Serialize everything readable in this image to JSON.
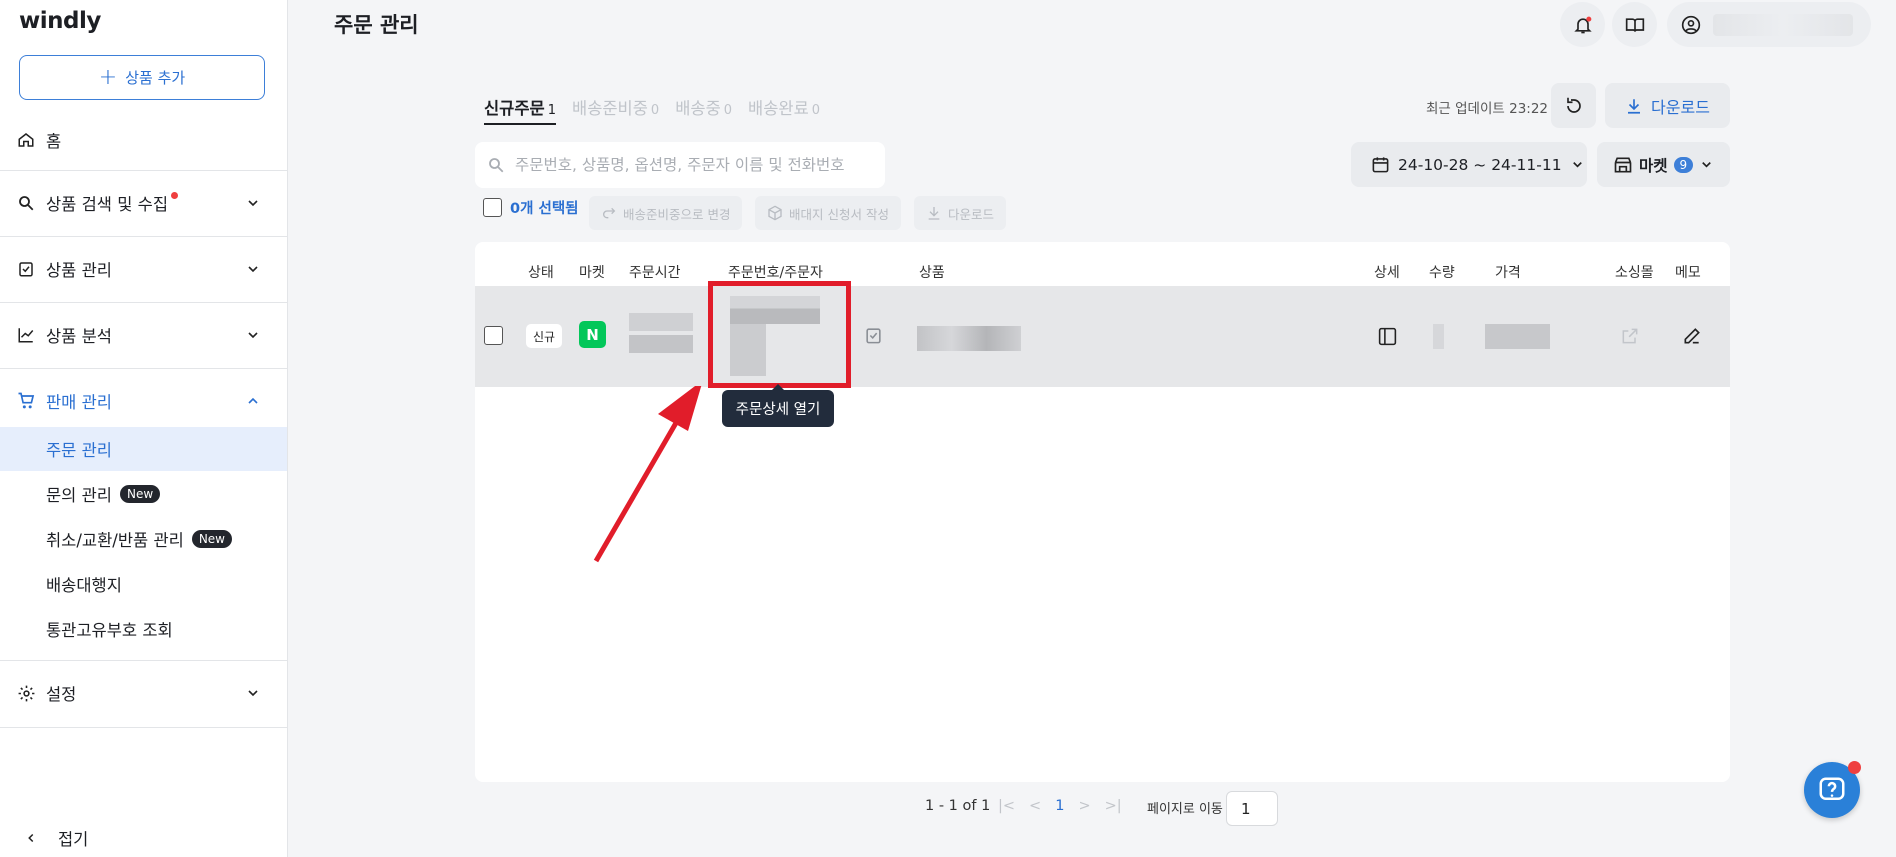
{
  "sidebar": {
    "logo": "windly",
    "add_button": "상품 추가",
    "home": "홈",
    "product_search": "상품 검색 및 수집",
    "product_manage": "상품 관리",
    "product_analysis": "상품 분석",
    "sales_manage": "판매 관리",
    "sub_items": [
      "주문 관리",
      "문의 관리",
      "취소/교환/반품 관리",
      "배송대행지",
      "통관고유부호 조회"
    ],
    "new_badge": "New",
    "settings": "설정",
    "collapse": "접기"
  },
  "header": {
    "title": "주문 관리"
  },
  "tabs": [
    {
      "label": "신규주문",
      "count": "1"
    },
    {
      "label": "배송준비중",
      "count": "0"
    },
    {
      "label": "배송중",
      "count": "0"
    },
    {
      "label": "배송완료",
      "count": "0"
    }
  ],
  "toolbar": {
    "last_update": "최근 업데이트 23:22",
    "download": "다운로드",
    "search_placeholder": "주문번호, 상품명, 옵션명, 주문자 이름 및 전화번호",
    "date_range": "24-10-28 ~ 24-11-11",
    "market_label": "마켓",
    "market_count": "9",
    "selected": "0개 선택됨",
    "change_status": "배송준비중으로 변경",
    "write_request": "배대지 신청서 작성",
    "download_small": "다운로드"
  },
  "table": {
    "headers": [
      "상태",
      "마켓",
      "주문시간",
      "주문번호/주문자",
      "상품",
      "상세",
      "수량",
      "가격",
      "소싱몰",
      "메모"
    ],
    "row": {
      "status": "신규",
      "market": "N"
    }
  },
  "tooltip": "주문상세 열기",
  "pagination": {
    "range": "1 - 1 of 1",
    "current": "1",
    "goto_label": "페이지로 이동",
    "goto_value": "1"
  },
  "colors": {
    "accent": "#2a6fd1",
    "naver": "#03c75a",
    "highlight": "#e11d2a"
  }
}
